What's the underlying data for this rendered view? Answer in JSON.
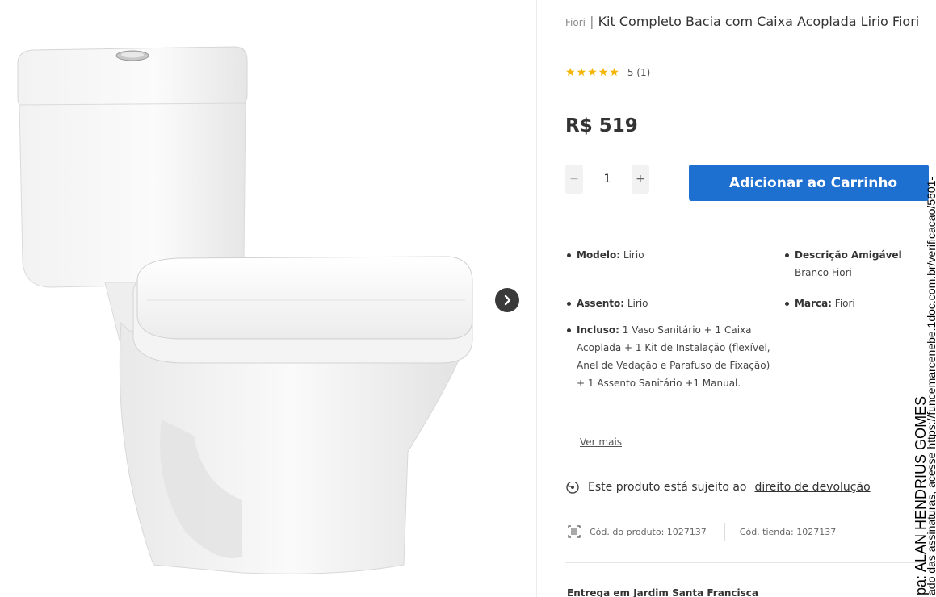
{
  "gallery": {
    "image_alt": "Kit Completo Bacia com Caixa Acoplada Lirio Fiori",
    "next_icon": "chevron-right-icon"
  },
  "product": {
    "brand": "Fiori",
    "separator": "|",
    "title": "Kit Completo Bacia com Caixa Acoplada Lirio Fiori",
    "rating": 5,
    "rating_text": "5 (1)",
    "price": "R$ 519",
    "quantity": "1",
    "qty_minus": "−",
    "qty_plus": "+",
    "add_to_cart": "Adicionar ao Carrinho"
  },
  "specs": {
    "modelo_label": "Modelo:",
    "modelo_value": "Lirio",
    "descricao_label": "Descrição Amigável",
    "descricao_value": "Branco Fiori",
    "assento_label": "Assento:",
    "assento_value": "Lirio",
    "marca_label": "Marca:",
    "marca_value": "Fiori",
    "incluso_label": "Incluso:",
    "incluso_value": "1 Vaso Sanitário + 1 Caixa Acoplada + 1 Kit de Instalação (flexível, Anel de Vedação e Parafuso de Fixação) + 1 Assento Sanitário +1 Manual.",
    "ver_mais": "Ver mais"
  },
  "return_policy": {
    "text": "Este produto está sujeito ao",
    "link": "direito de devolução",
    "icon": "return-policy-icon"
  },
  "codes": {
    "icon": "barcode-icon",
    "produto": "Cód. do produto: 1027137",
    "tienda": "Cód. tienda: 1027137"
  },
  "delivery": {
    "text": "Entrega em Jardim Santa Francisca"
  },
  "overlay": {
    "line1": "pa:  ALAN HENDRIUS GOMES",
    "line2": "ado das assinaturas, acesse https://funcemarcenebe.1doc.com.br/verificacao/5601-"
  },
  "colors": {
    "accent": "#1d6fd0",
    "star": "#f4b400",
    "arrow_bg": "#3a3a3a"
  }
}
